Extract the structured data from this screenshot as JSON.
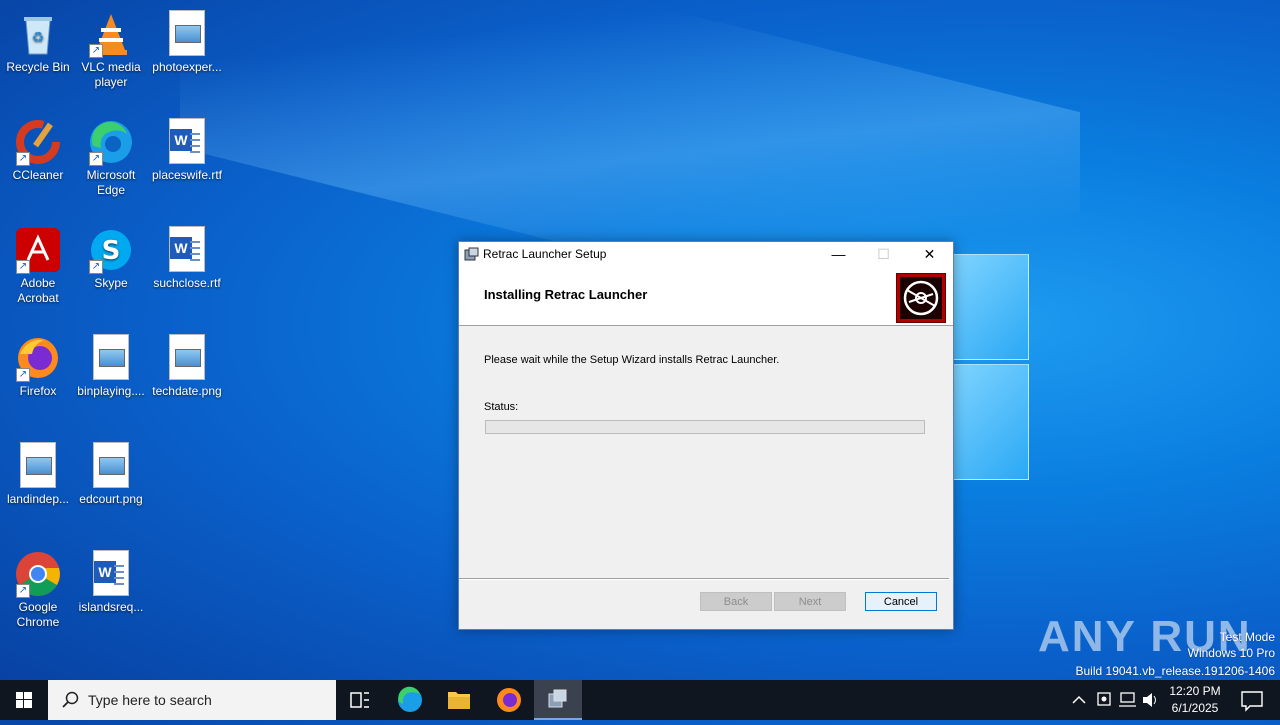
{
  "desktop": {
    "icons": [
      {
        "label": "Recycle Bin"
      },
      {
        "label": "VLC media player"
      },
      {
        "label": "photoexper..."
      },
      {
        "label": "CCleaner"
      },
      {
        "label": "Microsoft Edge"
      },
      {
        "label": "placeswife.rtf"
      },
      {
        "label": "Adobe Acrobat"
      },
      {
        "label": "Skype"
      },
      {
        "label": "suchclose.rtf"
      },
      {
        "label": "Firefox"
      },
      {
        "label": "binplaying...."
      },
      {
        "label": "techdate.png"
      },
      {
        "label": "landindep..."
      },
      {
        "label": "edcourt.png"
      },
      {
        "label": "Google Chrome"
      },
      {
        "label": "islandsreq..."
      }
    ]
  },
  "dialog": {
    "title": "Retrac Launcher Setup",
    "minimize": "—",
    "maximize": "☐",
    "close": "✕",
    "header_title": "Installing Retrac Launcher",
    "message": "Please wait while the Setup Wizard installs Retrac Launcher.",
    "status_label": "Status:",
    "progress": 0,
    "back_label": "Back",
    "next_label": "Next",
    "cancel_label": "Cancel"
  },
  "watermark": {
    "brand": "ANY RUN",
    "line1": "Test Mode",
    "line2": "Windows 10 Pro",
    "line3": "Build 19041.vb_release.191206-1406"
  },
  "taskbar": {
    "search_placeholder": "Type here to search",
    "time": "12:20 PM",
    "date": "6/1/2025",
    "accent": "#0078d7"
  }
}
